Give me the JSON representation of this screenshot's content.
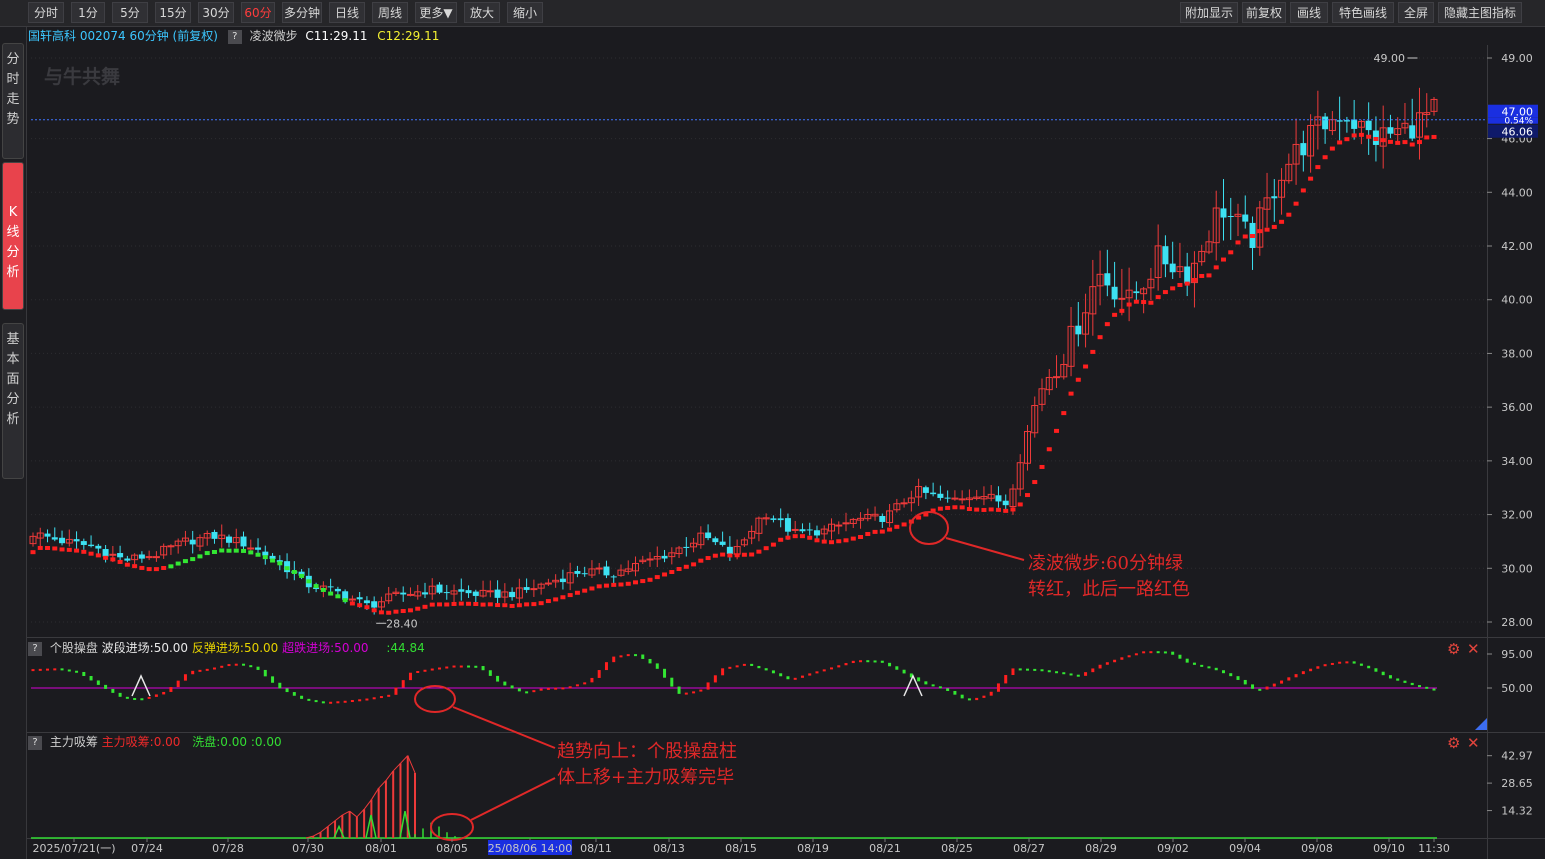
{
  "toolbar": {
    "periods": [
      "分时",
      "1分",
      "5分",
      "15分",
      "30分",
      "60分",
      "多分钟",
      "日线",
      "周线",
      "更多▼",
      "放大",
      "缩小"
    ],
    "active_period": "60分",
    "right_buttons": [
      "附加显示",
      "前复权",
      "画线",
      "特色画线",
      "全屏",
      "隐藏主图指标"
    ]
  },
  "sidebar": {
    "tabs": [
      "分时走势",
      "K线分析",
      "基本面分析"
    ],
    "active": "K线分析"
  },
  "info": {
    "stock": "国轩高科 002074 60分钟",
    "adjust": "(前复权)",
    "indicator": "凌波微步",
    "c1": "C11:29.11",
    "c2": "C12:29.11",
    "watermark": "与牛共舞"
  },
  "colors": {
    "up": "#ee3a3a",
    "down": "#3de1f2",
    "red_dot": "#ff1f1f",
    "green_dot": "#33e633",
    "magenta_line": "#d400d4",
    "annotation": "#e02828",
    "price_tag_blue": "#1a2fe0"
  },
  "chart_data": [
    {
      "type": "candlestick",
      "name": "main",
      "yticks": [
        "49.00",
        "46.00",
        "44.00",
        "42.00",
        "40.00",
        "38.00",
        "36.00",
        "34.00",
        "32.00",
        "30.00",
        "28.00"
      ],
      "ylim": [
        27.6,
        49.6
      ],
      "tags": {
        "last": "47.00",
        "pct": "0.54%",
        "line": "46.06"
      },
      "high_label": "49.00",
      "low_label": "28.40",
      "xlabels": [
        "2025/07/21(一)",
        "07/24",
        "07/28",
        "07/30",
        "08/01",
        "08/05",
        "25/08/06 14:00",
        "08/11",
        "08/13",
        "08/15",
        "08/19",
        "08/21",
        "08/25",
        "08/27",
        "08/29",
        "09/02",
        "09/04",
        "09/08",
        "09/10",
        "11:30"
      ],
      "anchor_closes": [
        31.3,
        31.0,
        30.8,
        30.3,
        30.5,
        31.0,
        31.2,
        30.9,
        30.3,
        29.4,
        29.1,
        28.6,
        29.0,
        29.2,
        29.1,
        29.0,
        29.1,
        29.5,
        29.9,
        29.8,
        30.2,
        30.6,
        31.2,
        30.5,
        32.1,
        31.3,
        31.4,
        31.8,
        31.9,
        32.9,
        32.5,
        32.8,
        32.4,
        36.5,
        38.3,
        41.0,
        39.9,
        41.6,
        41.0,
        43.5,
        42.2,
        44.8,
        46.2,
        47.0,
        46.0,
        46.3,
        47.0
      ],
      "ma_line": {
        "name": "凌波微步",
        "start": 30.6,
        "trough": 29.0,
        "end": 46.06
      }
    },
    {
      "type": "line",
      "name": "个股操盘",
      "series": [
        {
          "label": "波段进场:50.00",
          "color": "#e8e8e8"
        },
        {
          "label": "反弹进场:50.00",
          "color": "#e6d200"
        },
        {
          "label": "超跌进场:50.00",
          "color": "#d400d4"
        },
        {
          "label": ":44.84",
          "color": "#33dd33"
        }
      ],
      "yticks": [
        "95.00",
        "50.00"
      ],
      "ylim": [
        0,
        110
      ],
      "anchors": [
        75,
        76,
        71,
        53,
        37,
        36,
        46,
        72,
        76,
        83,
        77,
        51,
        36,
        31,
        33,
        36,
        41,
        71,
        76,
        80,
        79,
        56,
        44,
        50,
        51,
        59,
        91,
        96,
        78,
        42,
        47,
        76,
        82,
        73,
        61,
        70,
        78,
        87,
        86,
        72,
        56,
        48,
        33,
        42,
        76,
        75,
        71,
        66,
        81,
        91,
        99,
        98,
        82,
        76,
        64,
        46,
        58,
        71,
        81,
        86,
        77,
        63,
        54,
        47
      ]
    },
    {
      "type": "bar",
      "name": "主力吸筹",
      "series": [
        {
          "label": "主力吸筹:0.00",
          "color": "#ee2a2a"
        },
        {
          "label": "洗盘:0.00",
          "color": "#33dd33"
        },
        {
          "label": ":0.00",
          "color": "#33dd33"
        }
      ],
      "yticks": [
        "42.97",
        "28.65",
        "14.32"
      ],
      "ylim": [
        0,
        49.5
      ],
      "red_bars": [
        0,
        1,
        3,
        6,
        9,
        12,
        14,
        11,
        15,
        20,
        26,
        30,
        35,
        39,
        43,
        34
      ],
      "green_bars": [
        2,
        5,
        8,
        6,
        3,
        1,
        0.5
      ]
    }
  ],
  "annotations": [
    "凌波微步:60分钟绿\n转红，此后一路红色",
    "趋势向上：个股操盘柱\n体上移+主力吸筹完毕"
  ]
}
